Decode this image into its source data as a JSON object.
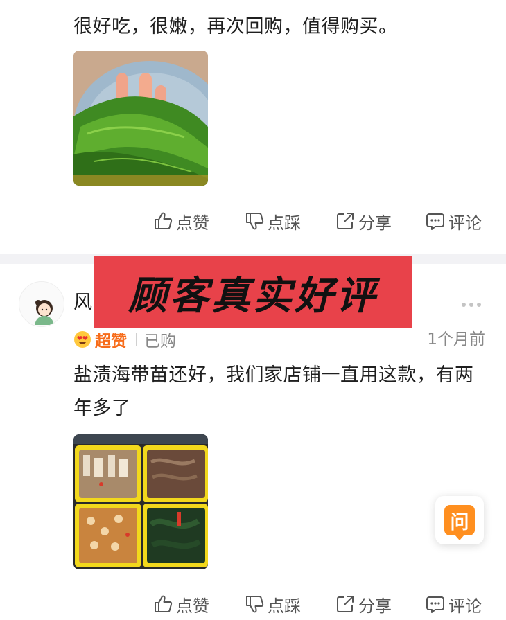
{
  "review1": {
    "text": "很好吃，很嫩，再次回购，值得购买。",
    "photo_icon": "kelp-photo",
    "actions": {
      "like": "点赞",
      "dislike": "点踩",
      "share": "分享",
      "comment": "评论"
    }
  },
  "banner": {
    "text": "顾客真实好评",
    "color": "#e8424a"
  },
  "review2": {
    "username": "风",
    "avatar_icon": "cartoon-girl-avatar",
    "rating_icon": "heart-eyes-emoji",
    "rating_label": "超赞",
    "purchased_label": "已购",
    "date": "1个月前",
    "text": "盐渍海带苗还好，我们家店铺一直用这款，有两年多了",
    "photo_icon": "food-trays-photo",
    "actions": {
      "like": "点赞",
      "dislike": "点踩",
      "share": "分享",
      "comment": "评论"
    }
  },
  "ask_button": {
    "label": "问",
    "color": "#ff8f1f"
  },
  "colors": {
    "accent": "#f76c1a",
    "muted": "#888888",
    "divider": "#f2f2f5"
  }
}
